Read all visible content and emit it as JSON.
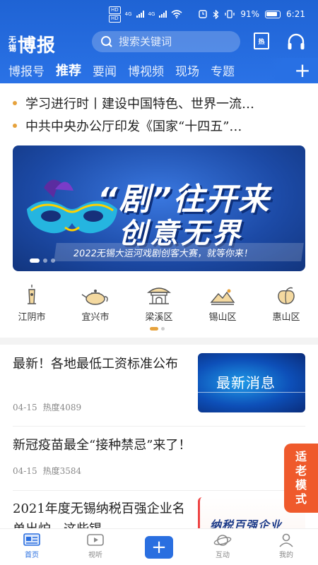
{
  "status_bar": {
    "network_chip_top": "HD",
    "network_chip_bottom": "HD",
    "signal_label_1": "4G",
    "signal_label_2": "4G",
    "battery": "91%",
    "time": "6:21"
  },
  "header": {
    "logo_small": "无锡",
    "logo_big": "博报",
    "search_placeholder": "搜索关键词",
    "hot_label": "热",
    "tabs": [
      {
        "label": "博报号"
      },
      {
        "label": "推荐"
      },
      {
        "label": "要闻"
      },
      {
        "label": "博视频"
      },
      {
        "label": "现场"
      },
      {
        "label": "专题"
      }
    ],
    "active_tab": "推荐",
    "plus_label": "+"
  },
  "headlines": [
    {
      "text": "学习进行时丨建设中国特色、世界一流…"
    },
    {
      "text": "中共中央办公厅印发《国家“十四五”…"
    }
  ],
  "banner": {
    "title_line1": "“剧”往开来",
    "title_line2": "创意无界",
    "subtitle": "2022无锡大运河戏剧创客大赛，就等你来！"
  },
  "districts": [
    {
      "label": "江阴市",
      "icon": "tower-icon"
    },
    {
      "label": "宜兴市",
      "icon": "teapot-icon"
    },
    {
      "label": "梁溪区",
      "icon": "pavilion-icon"
    },
    {
      "label": "锡山区",
      "icon": "mountain-icon"
    },
    {
      "label": "惠山区",
      "icon": "peach-icon"
    }
  ],
  "news": [
    {
      "title": "最新！各地最低工资标准公布",
      "date": "04-15",
      "heat": "热度4089",
      "thumb_text": "最新消息"
    },
    {
      "title": "新冠疫苗最全“接种禁忌”来了！",
      "date": "04-15",
      "heat": "热度3584"
    },
    {
      "title": "2021年度无锡纳税百强企业名单出炉，这些锡…",
      "thumb_text": "纳税百强企业"
    }
  ],
  "elder_mode": "适老模式",
  "bottom_nav": [
    {
      "label": "首页",
      "icon": "home-news-icon"
    },
    {
      "label": "视听",
      "icon": "video-icon"
    },
    {
      "label": "",
      "icon": "plus-icon"
    },
    {
      "label": "互动",
      "icon": "planet-icon"
    },
    {
      "label": "我的",
      "icon": "user-icon"
    }
  ],
  "colors": {
    "brand_blue": "#2a6fe0",
    "active_underline": "#ffd000",
    "headline_dot": "#e6a23c",
    "elder_orange": "#ef5a2c"
  }
}
